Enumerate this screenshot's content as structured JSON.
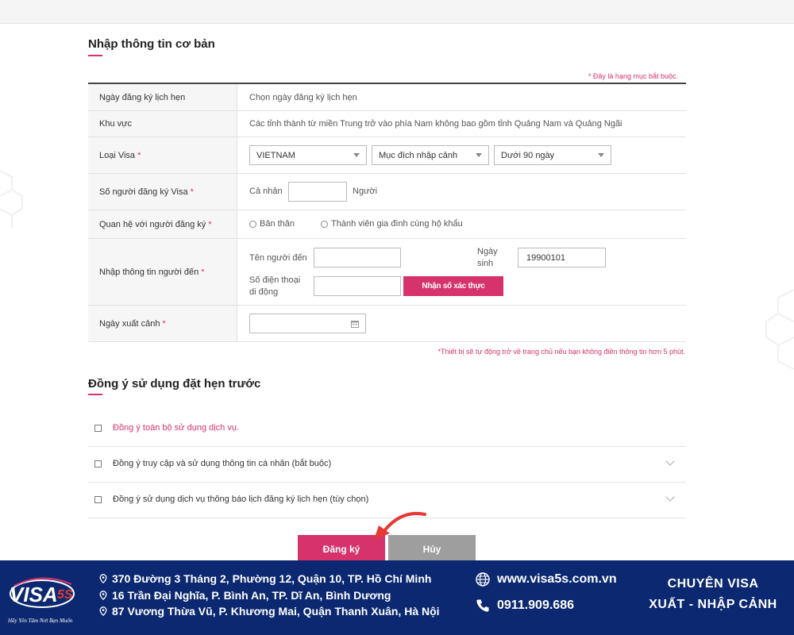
{
  "basic_info": {
    "title": "Nhập thông tin cơ bản",
    "required_note": "* Đây là hạng mục bắt buộc.",
    "rows": {
      "appointment_date": {
        "label": "Ngày đăng ký lịch hẹn",
        "value": "Chọn ngày đăng ký lịch hẹn"
      },
      "region": {
        "label": "Khu vực",
        "value": "Các tỉnh thành từ miền Trung trở vào phía Nam không bao gồm tỉnh Quảng Nam và Quảng Ngãi"
      },
      "visa_type": {
        "label": "Loại Visa",
        "req": "*",
        "country": "VIETNAM",
        "purpose": "Mục đích nhập cảnh",
        "duration": "Dưới 90 ngày"
      },
      "applicant_count": {
        "label": "Số người đăng ký Visa",
        "req": "*",
        "prefix": "Cả nhân",
        "value": "",
        "suffix": "Người"
      },
      "relationship": {
        "label": "Quan hệ với người đăng ký",
        "req": "*",
        "option_self": "Bản thân",
        "option_family": "Thành viên gia đình cùng hộ khẩu"
      },
      "visitor_info": {
        "label": "Nhập thông tin người đến",
        "req": "*",
        "name_label": "Tên người đến",
        "name_value": "",
        "dob_label_1": "Ngày",
        "dob_label_2": "sinh",
        "dob_value": "19900101",
        "phone_label_1": "Số điện thoại",
        "phone_label_2": "di động",
        "phone_value": "",
        "verify_button": "Nhận số xác thực"
      },
      "exit_date": {
        "label": "Ngày xuất cảnh",
        "req": "*",
        "value": ""
      }
    },
    "auto_return_note": "*Thiết bị sẽ tự động trở về trang chủ nếu bạn không điền thông tin hơn 5 phút."
  },
  "consent": {
    "title": "Đồng ý sử dụng đặt hẹn trước",
    "items": [
      {
        "label": "Đồng ý toàn bộ sử dụng dịch vụ."
      },
      {
        "label": "Đồng ý truy cập và sử dụng thông tin cá nhân (bắt buộc)"
      },
      {
        "label": "Đồng ý sử dụng dịch vụ thông báo lịch đăng ký lịch hẹn (tùy chọn)"
      }
    ]
  },
  "actions": {
    "submit": "Đăng ký",
    "cancel": "Hủy"
  },
  "footer": {
    "brand": "VISA5S",
    "tagline": "Hãy Yên Tâm Nơi Bạn Muốn",
    "addresses": [
      "370 Đường 3 Tháng 2, Phường 12, Quận 10, TP. Hồ Chí Minh",
      "16 Trần Đại Nghĩa, P. Bình An, TP. Dĩ An, Bình Dương",
      "87 Vương Thừa Vũ, P. Khương Mai, Quận Thanh Xuân, Hà Nội"
    ],
    "website": "www.visa5s.com.vn",
    "phone": "0911.909.686",
    "slogan_1": "CHUYÊN VISA",
    "slogan_2": "XUẤT - NHẬP CẢNH"
  },
  "colors": {
    "accent": "#d6336c",
    "footer_bg": "#0b2870",
    "cancel": "#9e9e9e"
  }
}
